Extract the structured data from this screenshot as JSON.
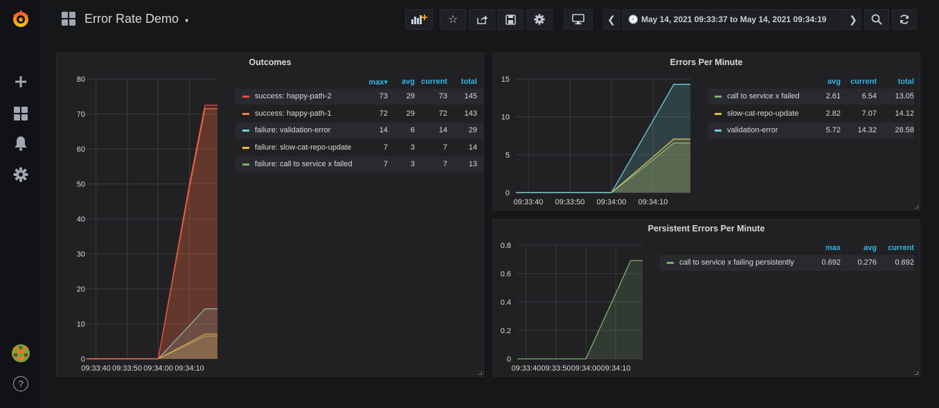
{
  "app": {
    "title": "Error Rate Demo",
    "time_range": "May 14, 2021 09:33:37 to May 14, 2021 09:34:19"
  },
  "sidebar": {
    "items": [
      "grafana-logo-icon",
      "plus-icon",
      "dashboards-icon",
      "bell-icon",
      "gear-icon",
      "avatar",
      "help-icon"
    ],
    "help_label": "?"
  },
  "colors": {
    "green": "#7eb26d",
    "yellow": "#eab839",
    "cyan": "#6ed0e0",
    "orange": "#ef843c",
    "red": "#e24d42",
    "accent": "#33b5e5"
  },
  "panels": {
    "outcomes": {
      "title": "Outcomes",
      "headers": [
        "max▾",
        "avg",
        "current",
        "total"
      ],
      "rows": [
        {
          "label": "success: happy-path-2",
          "color": "#e24d42",
          "values": [
            "73",
            "29",
            "73",
            "145"
          ]
        },
        {
          "label": "success: happy-path-1",
          "color": "#ef843c",
          "values": [
            "72",
            "29",
            "72",
            "143"
          ]
        },
        {
          "label": "failure: validation-error",
          "color": "#6ed0e0",
          "values": [
            "14",
            "6",
            "14",
            "29"
          ]
        },
        {
          "label": "failure: slow-cat-repo-update",
          "color": "#eab839",
          "values": [
            "7",
            "3",
            "7",
            "14"
          ]
        },
        {
          "label": "failure: call to service x failed",
          "color": "#7eb26d",
          "values": [
            "7",
            "3",
            "7",
            "13"
          ]
        }
      ]
    },
    "errors_per_minute": {
      "title": "Errors Per Minute",
      "headers": [
        "avg",
        "current",
        "total"
      ],
      "rows": [
        {
          "label": "call to service x failed",
          "color": "#7eb26d",
          "values": [
            "2.61",
            "6.54",
            "13.05"
          ]
        },
        {
          "label": "slow-cat-repo-update",
          "color": "#eab839",
          "values": [
            "2.82",
            "7.07",
            "14.12"
          ]
        },
        {
          "label": "validation-error",
          "color": "#6ed0e0",
          "values": [
            "5.72",
            "14.32",
            "28.58"
          ]
        }
      ]
    },
    "persistent_errors": {
      "title": "Persistent Errors Per Minute",
      "headers": [
        "max",
        "avg",
        "current"
      ],
      "rows": [
        {
          "label": "call to service x failing persistently",
          "color": "#7eb26d",
          "values": [
            "0.692",
            "0.276",
            "0.692"
          ]
        }
      ]
    }
  },
  "chart_data": [
    {
      "type": "area",
      "title": "Outcomes",
      "x": [
        "09:33:37",
        "09:33:40",
        "09:33:50",
        "09:34:00",
        "09:34:10",
        "09:34:15",
        "09:34:19"
      ],
      "xticks": [
        "09:33:40",
        "09:33:50",
        "09:34:00",
        "09:34:10"
      ],
      "yticks": [
        "0",
        "10",
        "20",
        "30",
        "40",
        "50",
        "60",
        "70",
        "80"
      ],
      "ylim": [
        0,
        80
      ],
      "series": [
        {
          "name": "success: happy-path-2",
          "color": "#e24d42",
          "values": [
            0,
            0,
            0,
            0,
            50,
            72.5,
            72.5
          ]
        },
        {
          "name": "success: happy-path-1",
          "color": "#ef843c",
          "values": [
            0,
            0,
            0,
            0,
            49,
            71.5,
            71.5
          ]
        },
        {
          "name": "failure: validation-error",
          "color": "#6ed0e0",
          "values": [
            0,
            0,
            0,
            0,
            9.5,
            14.3,
            14.3
          ]
        },
        {
          "name": "failure: slow-cat-repo-update",
          "color": "#eab839",
          "values": [
            0,
            0,
            0,
            0,
            4.7,
            7.1,
            7.1
          ]
        },
        {
          "name": "failure: call to service x failed",
          "color": "#7eb26d",
          "values": [
            0,
            0,
            0,
            0,
            4.3,
            6.5,
            6.5
          ]
        }
      ]
    },
    {
      "type": "area",
      "title": "Errors Per Minute",
      "x": [
        "09:33:37",
        "09:33:40",
        "09:33:50",
        "09:34:00",
        "09:34:10",
        "09:34:15",
        "09:34:19"
      ],
      "xticks": [
        "09:33:40",
        "09:33:50",
        "09:34:00",
        "09:34:10"
      ],
      "yticks": [
        "0",
        "5",
        "10",
        "15"
      ],
      "ylim": [
        0,
        15
      ],
      "series": [
        {
          "name": "validation-error",
          "color": "#6ed0e0",
          "values": [
            0,
            0,
            0,
            0,
            9.5,
            14.3,
            14.3
          ]
        },
        {
          "name": "slow-cat-repo-update",
          "color": "#eab839",
          "values": [
            0,
            0,
            0,
            0,
            4.7,
            7.07,
            7.07
          ]
        },
        {
          "name": "call to service x failed",
          "color": "#7eb26d",
          "values": [
            0,
            0,
            0,
            0,
            4.3,
            6.54,
            6.54
          ]
        }
      ]
    },
    {
      "type": "area",
      "title": "Persistent Errors Per Minute",
      "x": [
        "09:33:37",
        "09:33:40",
        "09:33:50",
        "09:34:00",
        "09:34:10",
        "09:34:15",
        "09:34:19"
      ],
      "xticks": [
        "09:33:40",
        "09:33:50",
        "09:34:00",
        "09:34:10"
      ],
      "yticks": [
        "0",
        "0.2",
        "0.4",
        "0.6",
        "0.8"
      ],
      "ylim": [
        0,
        0.8
      ],
      "series": [
        {
          "name": "call to service x failing persistently",
          "color": "#7eb26d",
          "values": [
            0,
            0,
            0,
            0,
            0.46,
            0.692,
            0.692
          ]
        }
      ]
    }
  ]
}
